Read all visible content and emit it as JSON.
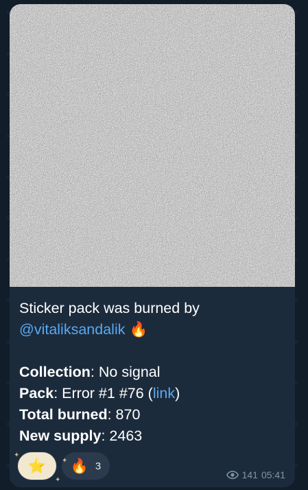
{
  "message": {
    "line1": "Sticker pack was burned by",
    "mention": "@vitaliksandalik",
    "fire_emoji": "🔥",
    "collection_label": "Collection",
    "collection_value": " No signal",
    "pack_label": "Pack",
    "pack_value": " Error #1 #76 (",
    "pack_link": "link",
    "pack_close": ")",
    "total_burned_label": "Total burned",
    "total_burned_value": " 870",
    "new_supply_label": "New supply",
    "new_supply_value": " 2463",
    "colon": ":"
  },
  "reactions": [
    {
      "emoji": "⭐",
      "count": ""
    },
    {
      "emoji": "🔥",
      "count": "3"
    }
  ],
  "meta": {
    "views": "141",
    "time": "05:41",
    "eye_icon": "eye-icon"
  },
  "colors": {
    "bubble": "#1c2b3c",
    "link": "#5aa9f0",
    "meta": "#8294a8"
  }
}
